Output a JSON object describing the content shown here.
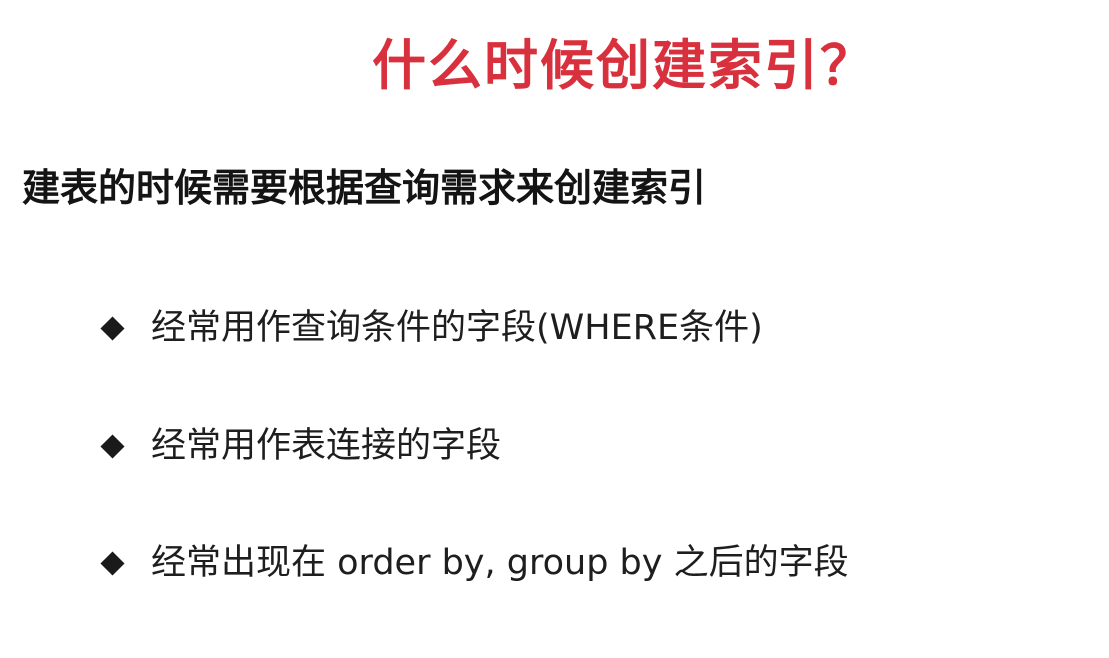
{
  "slide": {
    "title": "什么时候创建索引？",
    "subtitle": "建表的时候需要根据查询需求来创建索引",
    "bullets": [
      {
        "icon": "diamond-bullet-icon",
        "text": "经常用作查询条件的字段(WHERE条件)"
      },
      {
        "icon": "diamond-bullet-icon",
        "text": "经常用作表连接的字段"
      },
      {
        "icon": "diamond-bullet-icon",
        "text": "经常出现在 order by, group by 之后的字段"
      }
    ],
    "colors": {
      "title": "#d9303e",
      "text": "#1e1e1e",
      "background": "#ffffff"
    }
  }
}
